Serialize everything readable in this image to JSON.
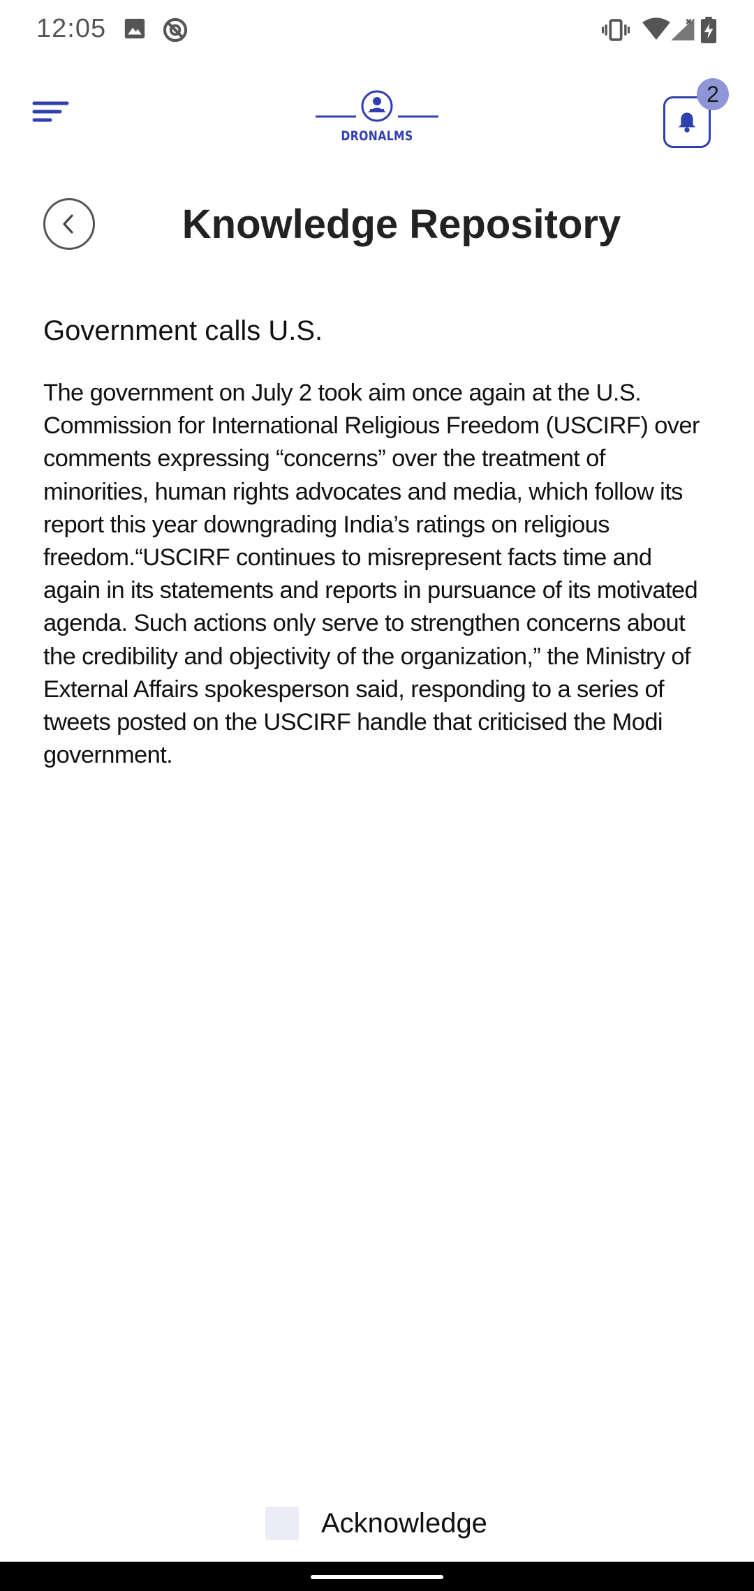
{
  "status_bar": {
    "time": "12:05",
    "left_icons": [
      "image-icon",
      "sync-icon"
    ],
    "right_icons": [
      "vibrate-icon",
      "wifi-icon",
      "signal-icon",
      "battery-charging-icon"
    ]
  },
  "header": {
    "logo_text": "DRONALMS",
    "notification_count": "2",
    "accent_color": "#2f3fb0"
  },
  "page": {
    "title": "Knowledge Repository"
  },
  "article": {
    "title": "Government calls U.S.",
    "body": "The government on July 2 took aim once again at the U.S. Commission for International Religious Freedom (USCIRF) over comments expressing “concerns” over the treatment of minorities, human rights advocates and media, which follow its report this year downgrading India’s ratings on religious freedom.“USCIRF continues to misrepresent facts time and again in its statements and reports in pursuance of its motivated agenda. Such actions only serve to strengthen concerns about the credibility and objectivity of the organization,” the Ministry of External Affairs spokesperson said, responding to a series of tweets posted on the USCIRF handle that criticised the Modi government."
  },
  "acknowledge": {
    "label": "Acknowledge",
    "checked": false
  }
}
